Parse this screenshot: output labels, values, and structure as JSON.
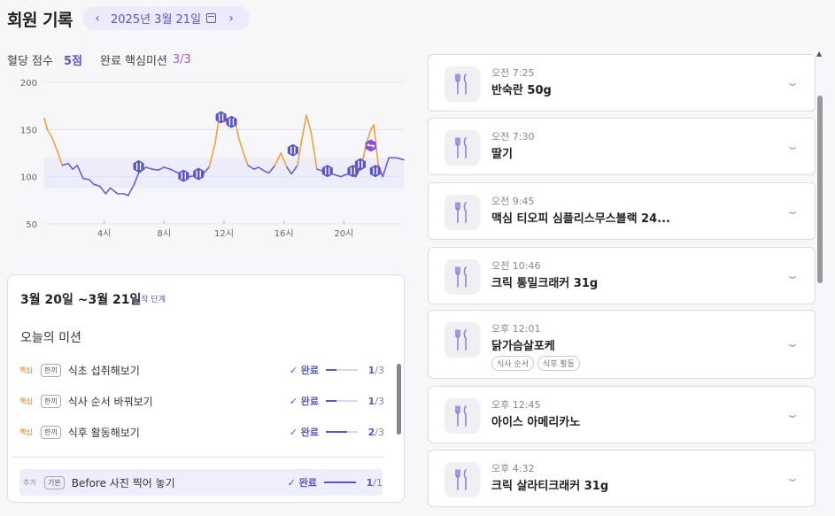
{
  "header": {
    "title": "회원 기록",
    "date": "2025년 3월 21일",
    "prev_icon": "chevron-left-icon",
    "next_icon": "chevron-right-icon",
    "calendar_icon": "calendar-icon"
  },
  "score": {
    "label": "혈당 점수",
    "value": "5점",
    "missions_label": "완료 핵심미션",
    "missions_value": "3/3"
  },
  "chart_data": {
    "type": "line",
    "title": "",
    "y_ticks": [
      "200",
      "150",
      "100",
      "50"
    ],
    "x_ticks": [
      "4시",
      "8시",
      "12시",
      "16시",
      "20시"
    ],
    "ylim": [
      50,
      200
    ],
    "xlim": [
      0,
      24
    ],
    "target_band": [
      88,
      120
    ],
    "colors": {
      "in_range": "#6a5fd0",
      "out_of_range": "#f0a23a",
      "band": "#ececfb"
    },
    "x": [
      0.0,
      0.2,
      0.5,
      0.9,
      1.2,
      1.6,
      1.9,
      2.2,
      2.6,
      3.0,
      3.3,
      3.7,
      4.1,
      4.4,
      4.9,
      5.3,
      5.6,
      6.0,
      6.3,
      6.8,
      7.2,
      7.6,
      8.0,
      8.4,
      8.8,
      9.2,
      9.7,
      10.2,
      10.6,
      11.0,
      11.4,
      11.7,
      12.0,
      12.3,
      12.7,
      13.0,
      13.3,
      13.6,
      14.0,
      14.3,
      14.7,
      15.0,
      15.4,
      15.8,
      16.2,
      16.5,
      16.9,
      17.2,
      17.5,
      17.8,
      18.2,
      18.6,
      19.0,
      19.4,
      19.8,
      20.1,
      20.4,
      20.8,
      21.2,
      21.5,
      21.8,
      22.0,
      22.3,
      22.6,
      23.0,
      23.5,
      24.0
    ],
    "values": [
      162,
      150,
      142,
      126,
      112,
      114,
      108,
      112,
      98,
      97,
      92,
      90,
      82,
      88,
      82,
      82,
      80,
      92,
      104,
      110,
      108,
      107,
      110,
      108,
      105,
      102,
      100,
      102,
      103,
      110,
      135,
      165,
      158,
      160,
      162,
      140,
      125,
      112,
      108,
      110,
      106,
      104,
      112,
      125,
      110,
      103,
      112,
      140,
      165,
      148,
      108,
      106,
      104,
      102,
      100,
      102,
      103,
      100,
      113,
      135,
      150,
      155,
      112,
      100,
      120,
      120,
      118
    ],
    "meal_markers": [
      {
        "x": 6.3,
        "y": 111,
        "label": "icon"
      },
      {
        "x": 9.3,
        "y": 101,
        "label": "icon"
      },
      {
        "x": 10.3,
        "y": 103,
        "label": "icon"
      },
      {
        "x": 11.8,
        "y": 163,
        "label": "icon"
      },
      {
        "x": 12.5,
        "y": 158,
        "label": "icon"
      },
      {
        "x": 16.6,
        "y": 128,
        "label": "icon"
      },
      {
        "x": 18.9,
        "y": 106,
        "label": "icon"
      },
      {
        "x": 20.6,
        "y": 106,
        "label": "icon"
      },
      {
        "x": 21.1,
        "y": 113,
        "label": "icon"
      },
      {
        "x": 21.8,
        "y": 133,
        "label": "swap"
      },
      {
        "x": 22.1,
        "y": 106,
        "label": "icon"
      }
    ]
  },
  "mission_card": {
    "range": "3월 20일 ~3월 21일",
    "stage": "시작 단계",
    "today_label": "오늘의 미션",
    "rows": [
      {
        "kind": "핵심",
        "tag": "한끼",
        "name": "식초 섭취해보기",
        "done": "✓ 완료",
        "done_count": "1",
        "total": "/3",
        "fraction": 0.33
      },
      {
        "kind": "핵심",
        "tag": "한끼",
        "name": "식사 순서 바꿔보기",
        "done": "✓ 완료",
        "done_count": "1",
        "total": "/3",
        "fraction": 0.33
      },
      {
        "kind": "핵심",
        "tag": "한끼",
        "name": "식후 활동해보기",
        "done": "✓ 완료",
        "done_count": "2",
        "total": "/3",
        "fraction": 0.67
      },
      {
        "kind": "추가",
        "tag": "기본",
        "name": "Before 사진 찍어 놓기",
        "done": "✓ 완료",
        "done_count": "1",
        "total": "/1",
        "fraction": 1.0
      }
    ]
  },
  "meals": [
    {
      "time": "오전 7:25",
      "name": "반숙란 50g",
      "chips": []
    },
    {
      "time": "오전 7:30",
      "name": "딸기",
      "chips": []
    },
    {
      "time": "오전 9:45",
      "name": "맥심 티오피 심플리스무스블랙 24...",
      "chips": []
    },
    {
      "time": "오전 10:46",
      "name": "크릭 통밀크래커 31g",
      "chips": []
    },
    {
      "time": "오후 12:01",
      "name": "닭가슴살포케",
      "chips": [
        "식사 순서",
        "식후 활동"
      ]
    },
    {
      "time": "오후 12:45",
      "name": "아이스 아메리카노",
      "chips": []
    },
    {
      "time": "오후 4:32",
      "name": "크릭 살라티크래커 31g",
      "chips": []
    }
  ]
}
